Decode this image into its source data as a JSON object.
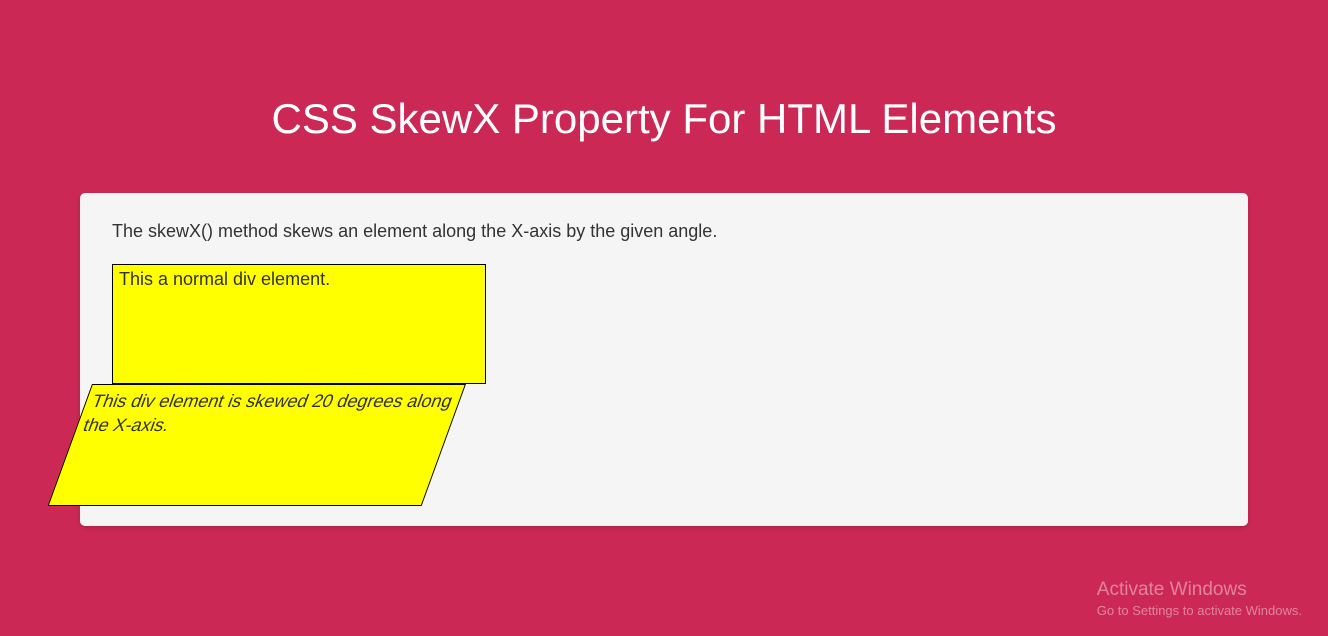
{
  "header": {
    "title": "CSS SkewX Property For HTML Elements"
  },
  "content": {
    "description": "The skewX() method skews an element along the X-axis by the given angle.",
    "box1_text": "This a normal div element.",
    "box2_text": "This div element is skewed 20 degrees along the X-axis."
  },
  "watermark": {
    "title": "Activate Windows",
    "subtitle": "Go to Settings to activate Windows."
  }
}
